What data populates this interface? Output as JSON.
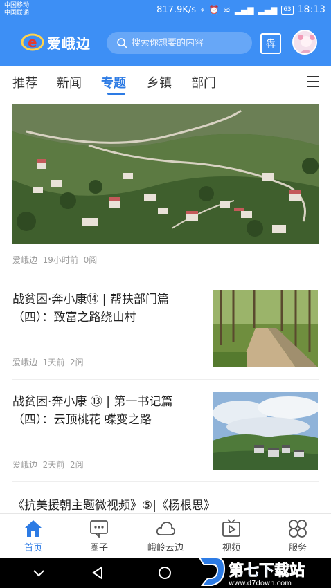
{
  "status_bar": {
    "carrier_1": "中国移动",
    "carrier_2": "中国联通",
    "speed": "817.9K/s",
    "battery": "63",
    "time": "18:13"
  },
  "header": {
    "logo_text": "爱峨边",
    "search_placeholder": "搜索你想要的内容",
    "calendar_label": "犇"
  },
  "tabs": [
    {
      "label": "推荐"
    },
    {
      "label": "新闻"
    },
    {
      "label": "专题",
      "active": true
    },
    {
      "label": "乡镇"
    },
    {
      "label": "部门"
    }
  ],
  "feed": {
    "items": [
      {
        "source": "爱峨边",
        "time": "19小时前",
        "reads": "0阅"
      },
      {
        "title": "战贫困·奔小康⑭ | 帮扶部门篇（四）：致富之路绕山村",
        "source": "爱峨边",
        "time": "1天前",
        "reads": "2阅"
      },
      {
        "title": "战贫困·奔小康 ⑬ | 第一书记篇（四）：云顶桃花 蝶变之路",
        "source": "爱峨边",
        "time": "2天前",
        "reads": "2阅"
      },
      {
        "title": "《抗美援朝主题微视频》⑤|《杨根思》"
      }
    ]
  },
  "bottom_nav": [
    {
      "label": "首页",
      "icon": "home-icon",
      "active": true
    },
    {
      "label": "圈子",
      "icon": "chat-icon"
    },
    {
      "label": "峨岭云边",
      "icon": "cloud-icon"
    },
    {
      "label": "视频",
      "icon": "video-icon"
    },
    {
      "label": "服务",
      "icon": "grid-flower-icon"
    }
  ],
  "watermark": {
    "text": "第七下载站",
    "url": "www.d7down.com"
  },
  "colors": {
    "brand_blue": "#3d8ff5",
    "active_tab": "#2d7be4",
    "meta_gray": "#9c9c9c"
  }
}
